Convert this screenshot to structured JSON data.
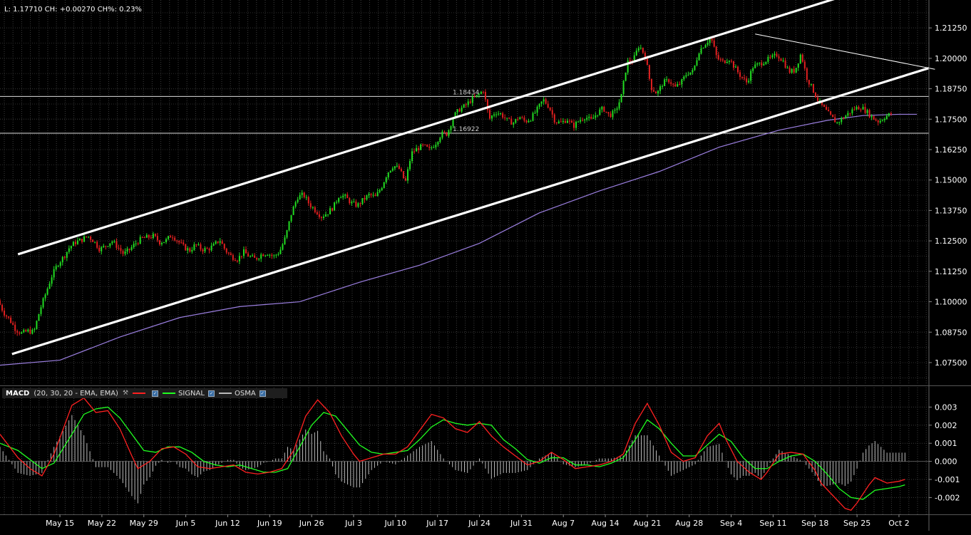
{
  "header": {
    "info_text": "L: 1.17710 CH: +0.00270 CH%: 0.23%"
  },
  "macd_legend": {
    "name": "MACD",
    "params": "(20, 30, 20 - EMA, EMA)",
    "wrench_icon": "wrench-icon",
    "macd_color": "#ff2020",
    "signal_label": "SIGNAL",
    "signal_color": "#20ff20",
    "osma_label": "OSMA",
    "osma_color": "#bbbbbb"
  },
  "chart_data": [
    {
      "type": "candlestick",
      "y_ticks": [
        "1.21250",
        "1.20000",
        "1.18750",
        "1.17500",
        "1.16250",
        "1.15000",
        "1.13750",
        "1.12500",
        "1.11250",
        "1.10000",
        "1.08750",
        "1.07500"
      ],
      "y_tick_values": [
        1.2125,
        1.2,
        1.1875,
        1.175,
        1.1625,
        1.15,
        1.1375,
        1.125,
        1.1125,
        1.1,
        1.0875,
        1.075
      ],
      "ylim": [
        1.0665,
        1.2225
      ],
      "x_labels": [
        "May 15",
        "May 22",
        "May 29",
        "Jun 5",
        "Jun 12",
        "Jun 19",
        "Jun 26",
        "Jul 3",
        "Jul 10",
        "Jul 17",
        "Jul 24",
        "Jul 31",
        "Aug 7",
        "Aug 14",
        "Aug 21",
        "Aug 28",
        "Sep 4",
        "Sep 11",
        "Sep 18",
        "Sep 25",
        "Oct 2"
      ],
      "x_label_days": [
        10,
        17,
        24,
        31,
        38,
        45,
        52,
        59,
        66,
        73,
        80,
        87,
        94,
        101,
        108,
        115,
        122,
        129,
        136,
        143,
        150
      ],
      "xlim_days": [
        0,
        155
      ],
      "price_path": [
        [
          0,
          1.1005
        ],
        [
          1,
          1.0955
        ],
        [
          2,
          1.0925
        ],
        [
          3,
          1.0885
        ],
        [
          4,
          1.087
        ],
        [
          5,
          1.088
        ],
        [
          6,
          1.0875
        ],
        [
          7,
          1.0965
        ],
        [
          8,
          1.1035
        ],
        [
          9,
          1.1105
        ],
        [
          10,
          1.1155
        ],
        [
          11,
          1.1185
        ],
        [
          12,
          1.1225
        ],
        [
          13,
          1.1245
        ],
        [
          14,
          1.1255
        ],
        [
          15,
          1.127
        ],
        [
          16,
          1.125
        ],
        [
          17,
          1.1215
        ],
        [
          18,
          1.123
        ],
        [
          19,
          1.125
        ],
        [
          20,
          1.1225
        ],
        [
          21,
          1.1195
        ],
        [
          22,
          1.1215
        ],
        [
          23,
          1.124
        ],
        [
          24,
          1.126
        ],
        [
          25,
          1.1265
        ],
        [
          26,
          1.127
        ],
        [
          27,
          1.1245
        ],
        [
          28,
          1.125
        ],
        [
          29,
          1.1275
        ],
        [
          30,
          1.125
        ],
        [
          31,
          1.1225
        ],
        [
          32,
          1.121
        ],
        [
          33,
          1.1235
        ],
        [
          34,
          1.1215
        ],
        [
          35,
          1.1215
        ],
        [
          36,
          1.123
        ],
        [
          37,
          1.1255
        ],
        [
          38,
          1.121
        ],
        [
          39,
          1.1185
        ],
        [
          40,
          1.1175
        ],
        [
          41,
          1.1205
        ],
        [
          42,
          1.1185
        ],
        [
          43,
          1.1175
        ],
        [
          44,
          1.1195
        ],
        [
          45,
          1.12
        ],
        [
          46,
          1.1185
        ],
        [
          47,
          1.1205
        ],
        [
          48,
          1.1265
        ],
        [
          49,
          1.1365
        ],
        [
          50,
          1.143
        ],
        [
          51,
          1.144
        ],
        [
          52,
          1.14
        ],
        [
          53,
          1.1375
        ],
        [
          54,
          1.135
        ],
        [
          55,
          1.1365
        ],
        [
          56,
          1.139
        ],
        [
          57,
          1.144
        ],
        [
          58,
          1.143
        ],
        [
          59,
          1.1405
        ],
        [
          60,
          1.1395
        ],
        [
          61,
          1.142
        ],
        [
          62,
          1.144
        ],
        [
          63,
          1.143
        ],
        [
          64,
          1.147
        ],
        [
          65,
          1.153
        ],
        [
          66,
          1.156
        ],
        [
          67,
          1.1545
        ],
        [
          68,
          1.149
        ],
        [
          69,
          1.161
        ],
        [
          70,
          1.163
        ],
        [
          71,
          1.164
        ],
        [
          72,
          1.1625
        ],
        [
          73,
          1.165
        ],
        [
          74,
          1.169
        ],
        [
          75,
          1.169
        ],
        [
          76,
          1.176
        ],
        [
          77,
          1.179
        ],
        [
          78,
          1.1805
        ],
        [
          79,
          1.183
        ],
        [
          80,
          1.1845
        ],
        [
          81,
          1.187
        ],
        [
          82,
          1.175
        ],
        [
          83,
          1.178
        ],
        [
          84,
          1.177
        ],
        [
          85,
          1.1745
        ],
        [
          86,
          1.1735
        ],
        [
          87,
          1.176
        ],
        [
          88,
          1.174
        ],
        [
          89,
          1.1755
        ],
        [
          90,
          1.179
        ],
        [
          91,
          1.183
        ],
        [
          92,
          1.18
        ],
        [
          93,
          1.174
        ],
        [
          94,
          1.1735
        ],
        [
          95,
          1.175
        ],
        [
          96,
          1.172
        ],
        [
          97,
          1.1745
        ],
        [
          98,
          1.176
        ],
        [
          99,
          1.1745
        ],
        [
          100,
          1.1775
        ],
        [
          101,
          1.1795
        ],
        [
          102,
          1.1765
        ],
        [
          103,
          1.178
        ],
        [
          104,
          1.184
        ],
        [
          105,
          1.1985
        ],
        [
          106,
          1.199
        ],
        [
          107,
          1.2055
        ],
        [
          108,
          1.201
        ],
        [
          109,
          1.188
        ],
        [
          110,
          1.1855
        ],
        [
          111,
          1.19
        ],
        [
          112,
          1.191
        ],
        [
          113,
          1.188
        ],
        [
          114,
          1.19
        ],
        [
          115,
          1.194
        ],
        [
          116,
          1.1945
        ],
        [
          117,
          1.203
        ],
        [
          118,
          1.206
        ],
        [
          119,
          1.2085
        ],
        [
          120,
          1.2
        ],
        [
          121,
          1.1985
        ],
        [
          122,
          1.2
        ],
        [
          123,
          1.196
        ],
        [
          124,
          1.1925
        ],
        [
          125,
          1.19
        ],
        [
          126,
          1.1965
        ],
        [
          127,
          1.1975
        ],
        [
          128,
          1.199
        ],
        [
          129,
          1.2
        ],
        [
          130,
          1.2015
        ],
        [
          131,
          1.199
        ],
        [
          132,
          1.1945
        ],
        [
          133,
          1.195
        ],
        [
          134,
          1.202
        ],
        [
          135,
          1.192
        ],
        [
          136,
          1.187
        ],
        [
          137,
          1.182
        ],
        [
          138,
          1.179
        ],
        [
          139,
          1.176
        ],
        [
          140,
          1.1735
        ],
        [
          141,
          1.1755
        ],
        [
          142,
          1.1775
        ],
        [
          143,
          1.1795
        ],
        [
          144,
          1.18
        ],
        [
          145,
          1.178
        ],
        [
          146,
          1.1755
        ],
        [
          147,
          1.174
        ],
        [
          148,
          1.176
        ],
        [
          149,
          1.1771
        ]
      ],
      "ema_line": [
        [
          -2,
          1.0735
        ],
        [
          10,
          1.076
        ],
        [
          20,
          1.0855
        ],
        [
          30,
          1.0935
        ],
        [
          40,
          1.098
        ],
        [
          50,
          1.1
        ],
        [
          60,
          1.108
        ],
        [
          70,
          1.115
        ],
        [
          80,
          1.124
        ],
        [
          90,
          1.1365
        ],
        [
          100,
          1.1455
        ],
        [
          110,
          1.1535
        ],
        [
          120,
          1.1635
        ],
        [
          130,
          1.1705
        ],
        [
          138,
          1.1745
        ],
        [
          144,
          1.1765
        ],
        [
          150,
          1.177
        ],
        [
          153,
          1.177
        ]
      ],
      "horizontal_lines": [
        {
          "value": 1.18434,
          "label": "1.18434"
        },
        {
          "value": 1.16922,
          "label": "1.16922"
        }
      ],
      "channel_lines": [
        {
          "from": [
            3,
            1.1195
          ],
          "to": [
            140,
            1.225
          ]
        },
        {
          "from": [
            2,
            1.0785
          ],
          "to": [
            155,
            1.196
          ]
        },
        {
          "from": [
            126,
            1.21
          ],
          "to": [
            156,
            1.1955
          ]
        }
      ],
      "grid": true
    },
    {
      "type": "macd",
      "y_ticks": [
        "0.003",
        "0.002",
        "0.001",
        "0.000",
        "-0.001",
        "-0.002"
      ],
      "y_tick_values": [
        0.003,
        0.002,
        0.001,
        0.0,
        -0.001,
        -0.002
      ],
      "ylim": [
        -0.00285,
        0.00345
      ],
      "macd": [
        [
          0,
          0.0015
        ],
        [
          3,
          0.0002
        ],
        [
          5,
          -0.0004
        ],
        [
          7,
          -0.0008
        ],
        [
          9,
          0.0004
        ],
        [
          12,
          0.0031
        ],
        [
          14,
          0.0035
        ],
        [
          16,
          0.0027
        ],
        [
          18,
          0.0028
        ],
        [
          20,
          0.0018
        ],
        [
          22,
          0.0003
        ],
        [
          23,
          -0.0004
        ],
        [
          25,
          0.0
        ],
        [
          27,
          0.0007
        ],
        [
          29,
          0.0008
        ],
        [
          31,
          0.0004
        ],
        [
          33,
          -0.0003
        ],
        [
          35,
          -0.0004
        ],
        [
          37,
          -0.0003
        ],
        [
          39,
          -0.0002
        ],
        [
          41,
          -0.0006
        ],
        [
          43,
          -0.0007
        ],
        [
          45,
          -0.0006
        ],
        [
          47,
          -0.0004
        ],
        [
          49,
          0.0006
        ],
        [
          51,
          0.0025
        ],
        [
          53,
          0.0034
        ],
        [
          55,
          0.0027
        ],
        [
          57,
          0.0014
        ],
        [
          59,
          0.0004
        ],
        [
          60,
          0.0
        ],
        [
          62,
          0.0002
        ],
        [
          64,
          0.0004
        ],
        [
          66,
          0.0004
        ],
        [
          68,
          0.0008
        ],
        [
          70,
          0.0017
        ],
        [
          72,
          0.0026
        ],
        [
          74,
          0.0024
        ],
        [
          76,
          0.0018
        ],
        [
          78,
          0.0016
        ],
        [
          80,
          0.0022
        ],
        [
          82,
          0.0014
        ],
        [
          84,
          0.0008
        ],
        [
          86,
          0.0003
        ],
        [
          88,
          -0.0002
        ],
        [
          90,
          0.0
        ],
        [
          92,
          0.0005
        ],
        [
          94,
          0.0001
        ],
        [
          96,
          -0.0004
        ],
        [
          98,
          -0.0003
        ],
        [
          100,
          -0.0002
        ],
        [
          102,
          0.0
        ],
        [
          104,
          0.0004
        ],
        [
          106,
          0.0021
        ],
        [
          108,
          0.0032
        ],
        [
          110,
          0.002
        ],
        [
          112,
          0.0005
        ],
        [
          114,
          0.0
        ],
        [
          116,
          0.0002
        ],
        [
          118,
          0.0014
        ],
        [
          120,
          0.0021
        ],
        [
          121,
          0.0013
        ],
        [
          123,
          0.0
        ],
        [
          125,
          -0.0006
        ],
        [
          127,
          -0.001
        ],
        [
          128,
          -0.0006
        ],
        [
          130,
          0.0004
        ],
        [
          132,
          0.0005
        ],
        [
          134,
          0.0004
        ],
        [
          136,
          -0.0005
        ],
        [
          137,
          -0.0012
        ],
        [
          139,
          -0.0019
        ],
        [
          141,
          -0.0026
        ],
        [
          142,
          -0.0027
        ],
        [
          143,
          -0.0023
        ],
        [
          145,
          -0.0013
        ],
        [
          146,
          -0.0009
        ],
        [
          148,
          -0.0012
        ],
        [
          150,
          -0.0011
        ],
        [
          151,
          -0.001
        ]
      ],
      "signal": [
        [
          0,
          0.001
        ],
        [
          3,
          0.0006
        ],
        [
          5,
          0.0001
        ],
        [
          7,
          -0.0004
        ],
        [
          9,
          -0.0001
        ],
        [
          12,
          0.0015
        ],
        [
          14,
          0.0026
        ],
        [
          16,
          0.0029
        ],
        [
          18,
          0.003
        ],
        [
          20,
          0.0024
        ],
        [
          22,
          0.0015
        ],
        [
          24,
          0.0006
        ],
        [
          26,
          0.0005
        ],
        [
          28,
          0.0008
        ],
        [
          30,
          0.0008
        ],
        [
          32,
          0.0005
        ],
        [
          34,
          0.0
        ],
        [
          36,
          -0.0002
        ],
        [
          38,
          -0.0003
        ],
        [
          40,
          -0.0002
        ],
        [
          42,
          -0.0004
        ],
        [
          44,
          -0.0006
        ],
        [
          46,
          -0.0006
        ],
        [
          48,
          -0.0004
        ],
        [
          50,
          0.0008
        ],
        [
          52,
          0.002
        ],
        [
          54,
          0.0027
        ],
        [
          56,
          0.0025
        ],
        [
          58,
          0.0017
        ],
        [
          60,
          0.0009
        ],
        [
          62,
          0.0005
        ],
        [
          64,
          0.0004
        ],
        [
          66,
          0.0005
        ],
        [
          68,
          0.0006
        ],
        [
          70,
          0.0012
        ],
        [
          72,
          0.0019
        ],
        [
          74,
          0.0023
        ],
        [
          76,
          0.0021
        ],
        [
          78,
          0.002
        ],
        [
          80,
          0.0021
        ],
        [
          82,
          0.002
        ],
        [
          84,
          0.0012
        ],
        [
          86,
          0.0007
        ],
        [
          88,
          0.0001
        ],
        [
          90,
          -0.0001
        ],
        [
          92,
          0.0002
        ],
        [
          94,
          0.0002
        ],
        [
          96,
          -0.0002
        ],
        [
          98,
          -0.0002
        ],
        [
          100,
          -0.0003
        ],
        [
          102,
          -0.0001
        ],
        [
          104,
          0.0002
        ],
        [
          106,
          0.0012
        ],
        [
          108,
          0.0023
        ],
        [
          110,
          0.0018
        ],
        [
          112,
          0.001
        ],
        [
          114,
          0.0003
        ],
        [
          116,
          0.0003
        ],
        [
          118,
          0.0009
        ],
        [
          120,
          0.0015
        ],
        [
          122,
          0.0011
        ],
        [
          124,
          0.0002
        ],
        [
          126,
          -0.0004
        ],
        [
          128,
          -0.0004
        ],
        [
          130,
          0.0
        ],
        [
          132,
          0.0003
        ],
        [
          134,
          0.0004
        ],
        [
          136,
          0.0
        ],
        [
          138,
          -0.0007
        ],
        [
          140,
          -0.0015
        ],
        [
          142,
          -0.002
        ],
        [
          144,
          -0.0021
        ],
        [
          146,
          -0.0016
        ],
        [
          148,
          -0.0015
        ],
        [
          150,
          -0.0014
        ],
        [
          151,
          -0.0013
        ]
      ],
      "zero_line": 0.0
    }
  ]
}
